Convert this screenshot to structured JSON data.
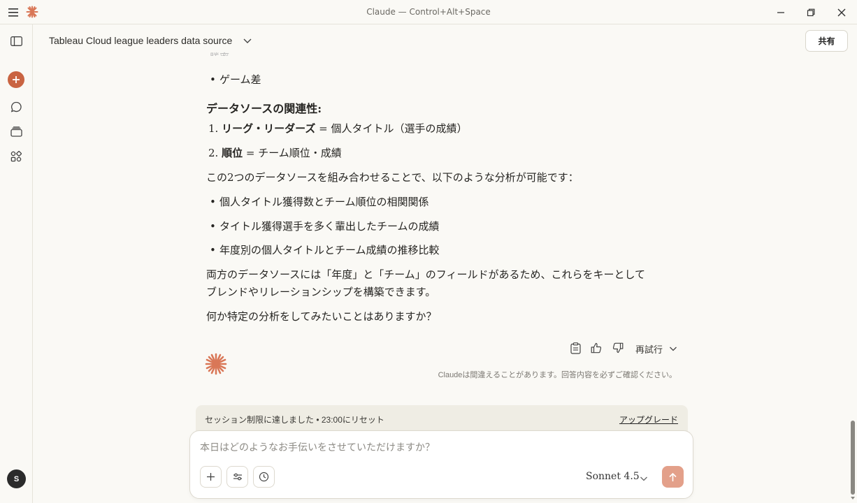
{
  "window": {
    "title": "Claude — Control+Alt+Space"
  },
  "header": {
    "conversation_title": "Tableau Cloud league leaders data source",
    "share_label": "共有"
  },
  "sidebar": {
    "avatar_initial": "S"
  },
  "message": {
    "faded_item": "勝率",
    "bullet_top": "ゲーム差",
    "heading": "データソースの関連性:",
    "numbered": [
      {
        "num": "1.",
        "bold": "リーグ・リーダーズ",
        "rest": " = 個人タイトル（選手の成績）"
      },
      {
        "num": "2.",
        "bold": "順位",
        "rest": " = チーム順位・成績"
      }
    ],
    "intro": "この2つのデータソースを組み合わせることで、以下のような分析が可能です：",
    "bullets": [
      "個人タイトル獲得数とチーム順位の相関関係",
      "タイトル獲得選手を多く輩出したチームの成績",
      "年度別の個人タイトルとチーム成績の推移比較"
    ],
    "para_line1": "両方のデータソースには「年度」と「チーム」のフィールドがあるため、これらをキーとして",
    "para_line2": "ブレンドやリレーションシップを構築できます。",
    "question": "何か特定の分析をしてみたいことはありますか？"
  },
  "actions": {
    "retry_label": "再試行"
  },
  "disclaimer": "Claudeは間違えることがあります。回答内容を必ずご確認ください。",
  "limit_banner": {
    "text": "セッション制限に達しました • 23:00にリセット",
    "upgrade_label": "アップグレード"
  },
  "composer": {
    "placeholder": "本日はどのようなお手伝いをさせていただけますか？",
    "model": "Sonnet 4.5"
  },
  "colors": {
    "accent": "#c96442",
    "send_disabled": "#e3a08a",
    "background": "#faf9f5"
  }
}
